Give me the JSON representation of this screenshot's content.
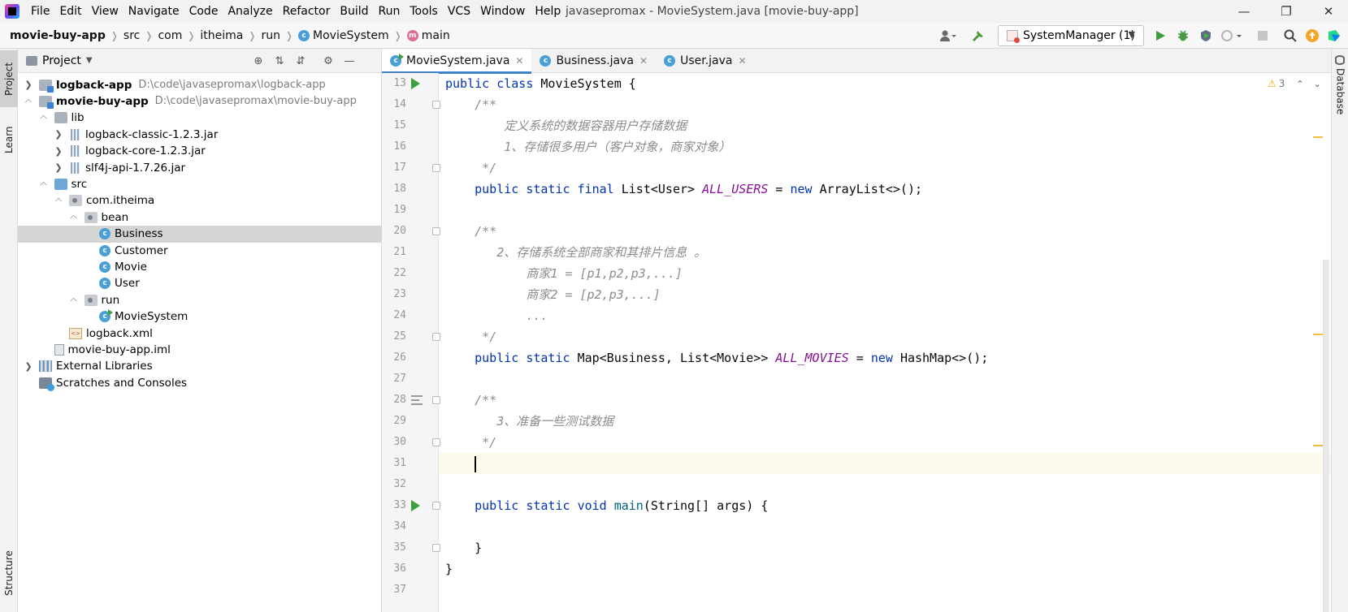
{
  "menubar": {
    "items": [
      "File",
      "Edit",
      "View",
      "Navigate",
      "Code",
      "Analyze",
      "Refactor",
      "Build",
      "Run",
      "Tools",
      "VCS",
      "Window",
      "Help"
    ],
    "window_title": "javasepromax - MovieSystem.java [movie-buy-app]"
  },
  "breadcrumbs": [
    "movie-buy-app",
    "src",
    "com",
    "itheima",
    "run",
    "MovieSystem",
    "main"
  ],
  "run_config": {
    "label": "SystemManager (1)"
  },
  "left_strip": {
    "project": "Project",
    "learn": "Learn",
    "structure": "Structure"
  },
  "right_strip": {
    "database": "Database"
  },
  "project_panel": {
    "title": "Project"
  },
  "tree": [
    {
      "depth": 0,
      "label": "logback-app",
      "path": "D:\\code\\javasepromax\\logback-app",
      "icon": "module",
      "chevron": "right",
      "bold": true
    },
    {
      "depth": 0,
      "label": "movie-buy-app",
      "path": "D:\\code\\javasepromax\\movie-buy-app",
      "icon": "module",
      "chevron": "down",
      "bold": true
    },
    {
      "depth": 1,
      "label": "lib",
      "icon": "folder",
      "chevron": "down"
    },
    {
      "depth": 2,
      "label": "logback-classic-1.2.3.jar",
      "icon": "jar",
      "chevron": "right"
    },
    {
      "depth": 2,
      "label": "logback-core-1.2.3.jar",
      "icon": "jar",
      "chevron": "right"
    },
    {
      "depth": 2,
      "label": "slf4j-api-1.7.26.jar",
      "icon": "jar",
      "chevron": "right"
    },
    {
      "depth": 1,
      "label": "src",
      "icon": "folder-src",
      "chevron": "down"
    },
    {
      "depth": 2,
      "label": "com.itheima",
      "icon": "package",
      "chevron": "down"
    },
    {
      "depth": 3,
      "label": "bean",
      "icon": "package",
      "chevron": "down"
    },
    {
      "depth": 4,
      "label": "Business",
      "icon": "class",
      "chevron": "none",
      "selected": true
    },
    {
      "depth": 4,
      "label": "Customer",
      "icon": "class",
      "chevron": "none"
    },
    {
      "depth": 4,
      "label": "Movie",
      "icon": "class",
      "chevron": "none"
    },
    {
      "depth": 4,
      "label": "User",
      "icon": "class",
      "chevron": "none"
    },
    {
      "depth": 3,
      "label": "run",
      "icon": "package",
      "chevron": "down"
    },
    {
      "depth": 4,
      "label": "MovieSystem",
      "icon": "class-run",
      "chevron": "none"
    },
    {
      "depth": 2,
      "label": "logback.xml",
      "icon": "xml",
      "chevron": "none"
    },
    {
      "depth": 1,
      "label": "movie-buy-app.iml",
      "icon": "iml",
      "chevron": "none"
    },
    {
      "depth": 0,
      "label": "External Libraries",
      "icon": "lib",
      "chevron": "right"
    },
    {
      "depth": 0,
      "label": "Scratches and Consoles",
      "icon": "scratch",
      "chevron": "none"
    }
  ],
  "tabs": [
    {
      "label": "MovieSystem.java",
      "active": true,
      "icon": "class-run"
    },
    {
      "label": "Business.java",
      "active": false,
      "icon": "class"
    },
    {
      "label": "User.java",
      "active": false,
      "icon": "class"
    }
  ],
  "editor": {
    "warning_count": "3",
    "lines": [
      {
        "num": "13",
        "tokens": [
          [
            "kw",
            "public "
          ],
          [
            "kw",
            "class "
          ],
          [
            "",
            "MovieSystem {"
          ]
        ],
        "gutter": "run"
      },
      {
        "num": "14",
        "tokens": [
          [
            "",
            "    "
          ],
          [
            "cm",
            "/**"
          ]
        ],
        "gutter": "fold"
      },
      {
        "num": "15",
        "tokens": [
          [
            "",
            "        "
          ],
          [
            "cm",
            "定义系统的数据容器用户存储数据"
          ]
        ]
      },
      {
        "num": "16",
        "tokens": [
          [
            "",
            "        "
          ],
          [
            "cm",
            "1、存储很多用户（客户对象，商家对象）"
          ]
        ]
      },
      {
        "num": "17",
        "tokens": [
          [
            "",
            "     "
          ],
          [
            "cm",
            "*/"
          ]
        ],
        "gutter": "fold"
      },
      {
        "num": "18",
        "tokens": [
          [
            "",
            "    "
          ],
          [
            "kw",
            "public "
          ],
          [
            "kw",
            "static "
          ],
          [
            "kw",
            "final "
          ],
          [
            "",
            "List<User> "
          ],
          [
            "sf",
            "ALL_USERS"
          ],
          [
            "",
            " = "
          ],
          [
            "kw",
            "new "
          ],
          [
            "",
            "ArrayList<>();"
          ]
        ]
      },
      {
        "num": "19",
        "tokens": []
      },
      {
        "num": "20",
        "tokens": [
          [
            "",
            "    "
          ],
          [
            "cm",
            "/**"
          ]
        ],
        "gutter": "fold"
      },
      {
        "num": "21",
        "tokens": [
          [
            "",
            "       "
          ],
          [
            "cm",
            "2、存储系统全部商家和其排片信息 。"
          ]
        ]
      },
      {
        "num": "22",
        "tokens": [
          [
            "",
            "           "
          ],
          [
            "cm",
            "商家1 = [p1,p2,p3,...]"
          ]
        ]
      },
      {
        "num": "23",
        "tokens": [
          [
            "",
            "           "
          ],
          [
            "cm",
            "商家2 = [p2,p3,...]"
          ]
        ]
      },
      {
        "num": "24",
        "tokens": [
          [
            "",
            "           "
          ],
          [
            "cm",
            "..."
          ]
        ]
      },
      {
        "num": "25",
        "tokens": [
          [
            "",
            "     "
          ],
          [
            "cm",
            "*/"
          ]
        ],
        "gutter": "fold"
      },
      {
        "num": "26",
        "tokens": [
          [
            "",
            "    "
          ],
          [
            "kw",
            "public "
          ],
          [
            "kw",
            "static "
          ],
          [
            "",
            "Map<Business, List<Movie>> "
          ],
          [
            "sf",
            "ALL_MOVIES"
          ],
          [
            "",
            " = "
          ],
          [
            "kw",
            "new "
          ],
          [
            "",
            "HashMap<>();"
          ]
        ]
      },
      {
        "num": "27",
        "tokens": []
      },
      {
        "num": "28",
        "tokens": [
          [
            "",
            "    "
          ],
          [
            "cm",
            "/**"
          ]
        ],
        "gutter": "fold-lines"
      },
      {
        "num": "29",
        "tokens": [
          [
            "",
            "       "
          ],
          [
            "cm",
            "3、准备一些测试数据"
          ]
        ]
      },
      {
        "num": "30",
        "tokens": [
          [
            "",
            "     "
          ],
          [
            "cm",
            "*/"
          ]
        ],
        "gutter": "fold"
      },
      {
        "num": "31",
        "tokens": [
          [
            "",
            "    "
          ]
        ],
        "caret": true,
        "current": true
      },
      {
        "num": "32",
        "tokens": []
      },
      {
        "num": "33",
        "tokens": [
          [
            "",
            "    "
          ],
          [
            "kw",
            "public "
          ],
          [
            "kw",
            "static "
          ],
          [
            "kw",
            "void "
          ],
          [
            "fn",
            "main"
          ],
          [
            "",
            "(String[] args) {"
          ]
        ],
        "gutter": "run-fold"
      },
      {
        "num": "34",
        "tokens": []
      },
      {
        "num": "35",
        "tokens": [
          [
            "",
            "    }"
          ]
        ],
        "gutter": "fold"
      },
      {
        "num": "36",
        "tokens": [
          [
            "",
            "}"
          ]
        ]
      },
      {
        "num": "37",
        "tokens": []
      }
    ]
  }
}
